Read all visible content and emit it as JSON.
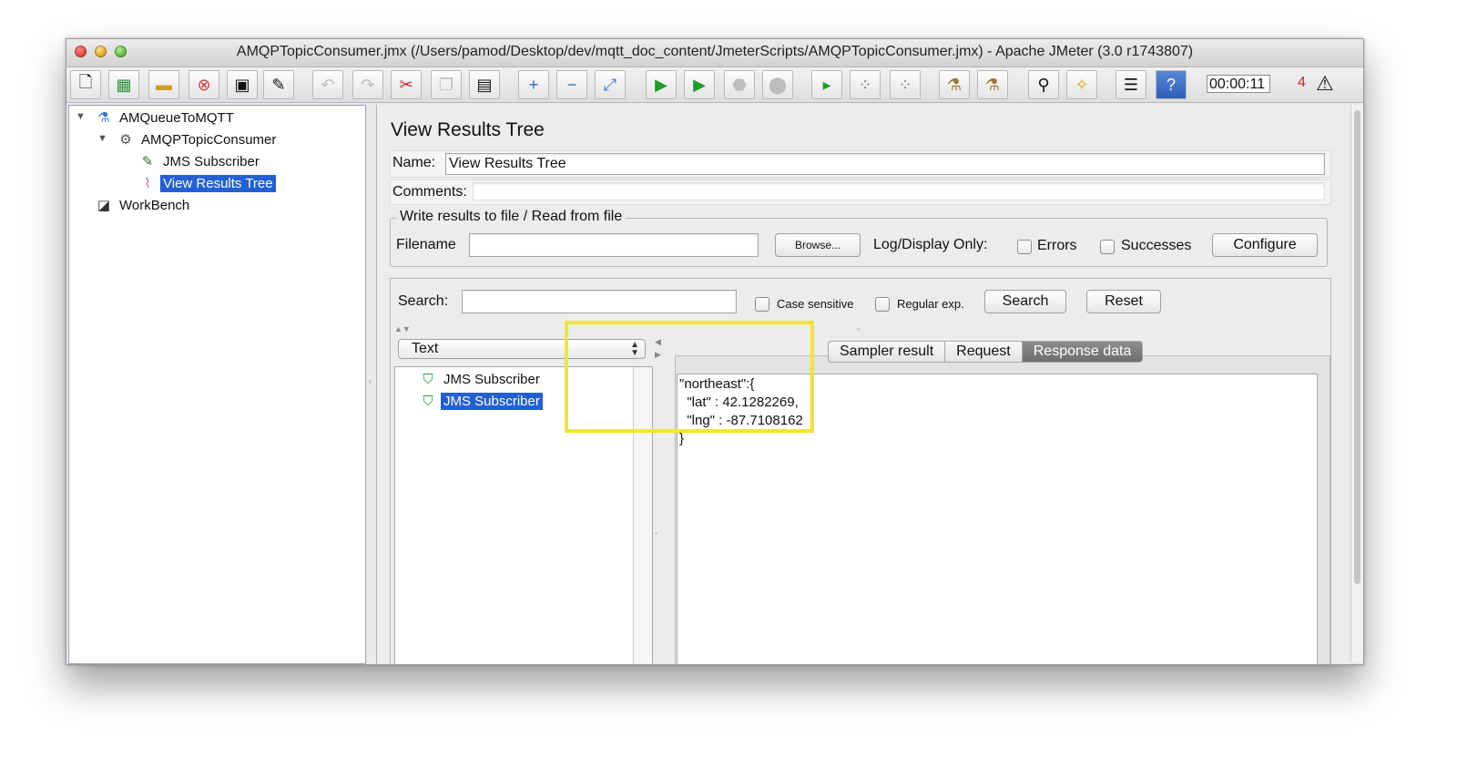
{
  "window": {
    "title": "AMQPTopicConsumer.jmx (/Users/pamod/Desktop/dev/mqtt_doc_content/JmeterScripts/AMQPTopicConsumer.jmx) - Apache JMeter (3.0 r1743807)"
  },
  "toolbar": {
    "timer": "00:00:11",
    "error_count": "4",
    "icons": [
      "new-icon",
      "templates-icon",
      "open-icon",
      "close-icon",
      "save-icon",
      "save-as-icon",
      "undo-icon",
      "redo-icon",
      "cut-icon",
      "copy-icon",
      "paste-icon",
      "expand-icon",
      "collapse-icon",
      "toggle-icon",
      "start-icon",
      "start-no-pause-icon",
      "stop-icon",
      "shutdown-icon",
      "remote-start-icon",
      "remote-stop-icon",
      "remote-shutdown-icon",
      "clear-icon",
      "clear-all-icon",
      "search-icon",
      "reset-search-icon",
      "function-helper-icon",
      "help-icon",
      "warning-icon"
    ]
  },
  "tree": {
    "root": "AMQueueToMQTT",
    "consumer": "AMQPTopicConsumer",
    "subscriber": "JMS Subscriber",
    "results_tree": "View Results Tree",
    "workbench": "WorkBench"
  },
  "panel": {
    "title": "View Results Tree",
    "name_label": "Name:",
    "name_value": "View Results Tree",
    "comments_label": "Comments:",
    "file_legend": "Write results to file / Read from file",
    "filename_label": "Filename",
    "browse_label": "Browse...",
    "log_display_label": "Log/Display Only:",
    "errors_label": "Errors",
    "successes_label": "Successes",
    "configure_label": "Configure"
  },
  "search": {
    "label": "Search:",
    "case_sensitive": "Case sensitive",
    "regular_exp": "Regular exp.",
    "search_button": "Search",
    "reset_button": "Reset"
  },
  "results": {
    "renderer": "Text",
    "samples": [
      "JMS Subscriber",
      "JMS Subscriber"
    ],
    "tabs": [
      "Sampler result",
      "Request",
      "Response data"
    ],
    "active_tab": "Response data",
    "response_lines": [
      "\"northeast\":{",
      "  \"lat\" : 42.1282269,",
      "  \"lng\" : -87.7108162",
      "}"
    ]
  },
  "colors": {
    "selection": "#2360d6",
    "highlight_box": "#f0e43a",
    "active_tab": "#7a7a7a",
    "error_count": "#d42020"
  }
}
